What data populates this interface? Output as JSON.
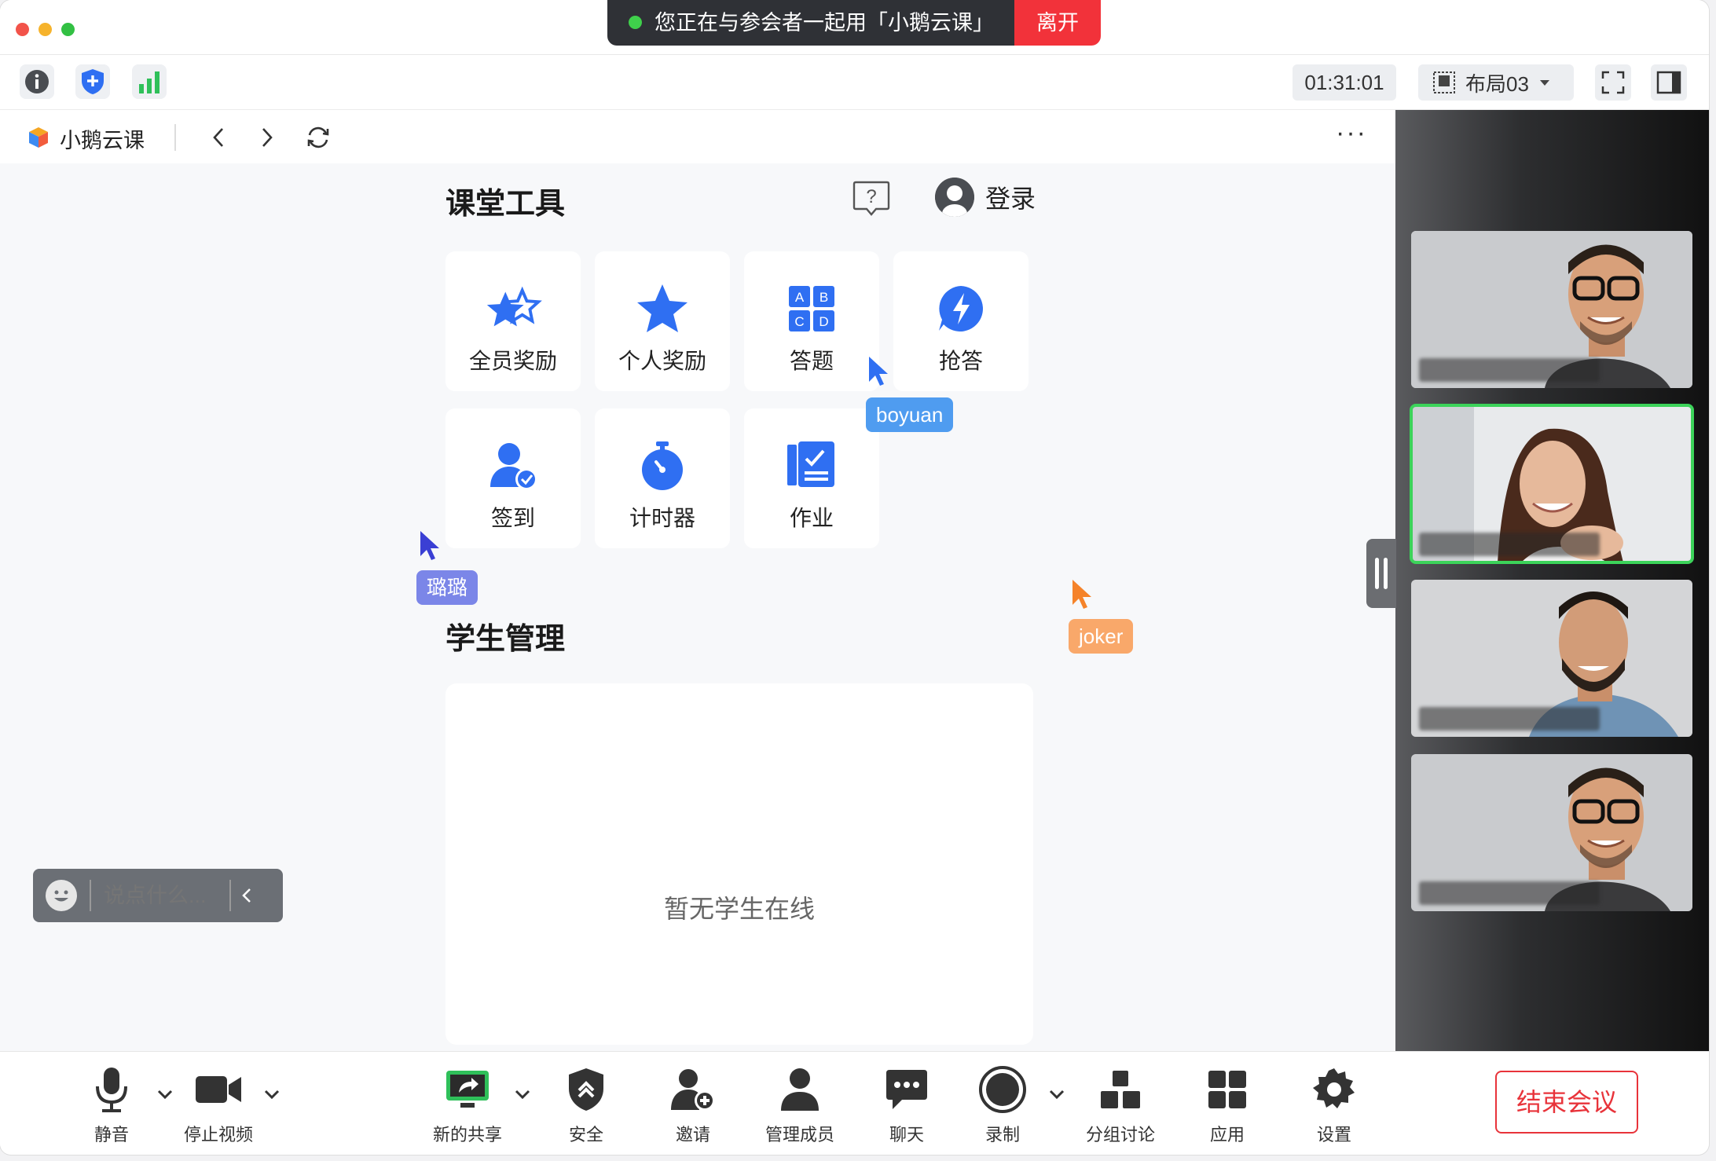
{
  "titlebar": {
    "share_text": "您正在与参会者一起用「小鹅云课」",
    "leave_label": "离开"
  },
  "toolbar": {
    "timer": "01:31:01",
    "layout_label": "布局03"
  },
  "browser": {
    "app_name": "小鹅云课",
    "more": "···"
  },
  "classroom": {
    "tools_title": "课堂工具",
    "login_label": "登录",
    "tools": [
      {
        "label": "全员奖励",
        "icon": "stars-icon"
      },
      {
        "label": "个人奖励",
        "icon": "star-icon"
      },
      {
        "label": "答题",
        "icon": "abcd-grid-icon"
      },
      {
        "label": "抢答",
        "icon": "lightning-bubble-icon"
      },
      {
        "label": "签到",
        "icon": "user-check-icon"
      },
      {
        "label": "计时器",
        "icon": "stopwatch-icon"
      },
      {
        "label": "作业",
        "icon": "homework-icon"
      }
    ],
    "students_title": "学生管理",
    "students_empty": "暂无学生在线"
  },
  "cursors": [
    {
      "name": "boyuan",
      "color": "#4f9cf0"
    },
    {
      "name": "璐璐",
      "color": "#7b86e8"
    },
    {
      "name": "joker",
      "color": "#f9a86a"
    }
  ],
  "chat": {
    "placeholder": "说点什么..."
  },
  "bottombar": {
    "mute": "静音",
    "stop_video": "停止视频",
    "new_share": "新的共享",
    "security": "安全",
    "invite": "邀请",
    "manage_members": "管理成员",
    "chat": "聊天",
    "record": "录制",
    "breakout": "分组讨论",
    "apps": "应用",
    "settings": "设置",
    "end_meeting": "结束会议"
  },
  "colors": {
    "accent_blue": "#2f6ff2",
    "danger_red": "#f2323a",
    "active_green": "#3cd35a"
  }
}
